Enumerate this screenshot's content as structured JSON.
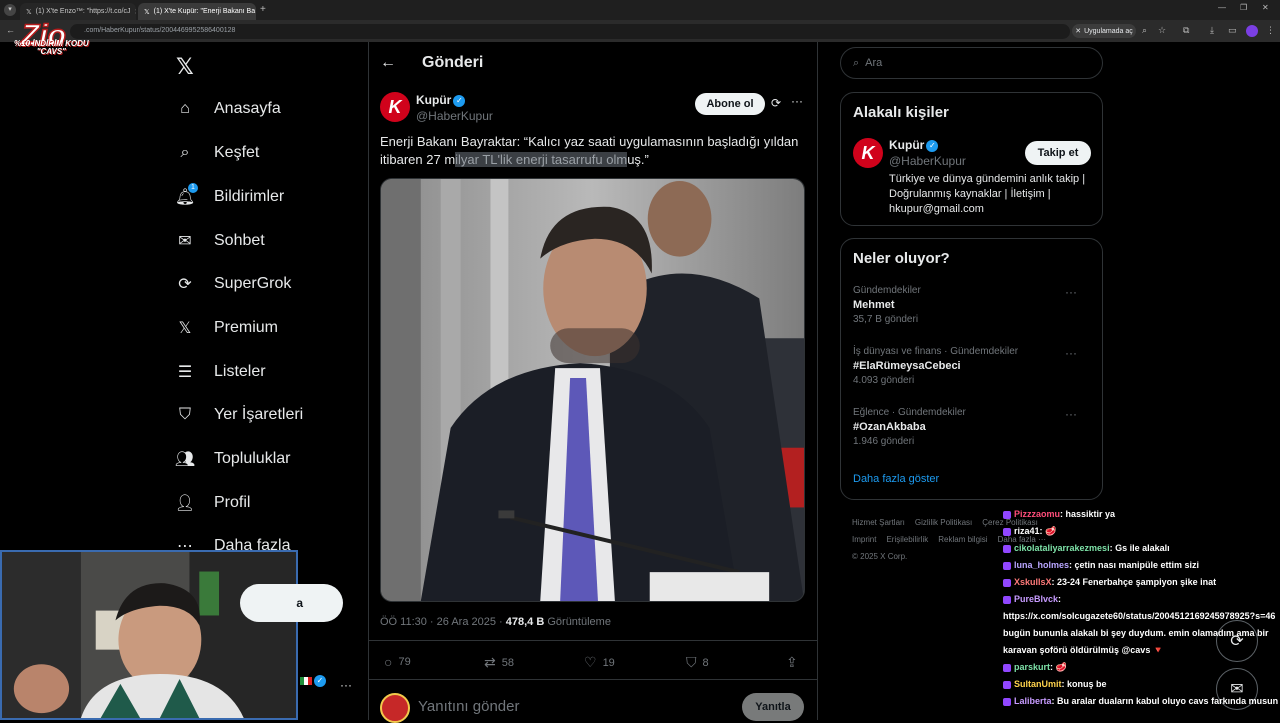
{
  "browser": {
    "tabs": [
      {
        "label": "(1) X'te Enzo™: \"https://t.co/cJ",
        "active": false
      },
      {
        "label": "(1) X'te Kupür: \"Enerji Bakanı Ba",
        "active": true
      }
    ],
    "url": ".com/HaberKupur/status/2004469952586400128",
    "promo_label": "Uygulamada aç"
  },
  "stream_logo": {
    "text": "Zio",
    "promo_line1": "%10 İNDİRİM KODU",
    "promo_line2": "\"CAVS\""
  },
  "nav": {
    "items": [
      {
        "label": "Anasayfa",
        "icon": "home-icon"
      },
      {
        "label": "Keşfet",
        "icon": "search-icon"
      },
      {
        "label": "Bildirimler",
        "icon": "bell-icon",
        "badge": "1"
      },
      {
        "label": "Sohbet",
        "icon": "mail-icon"
      },
      {
        "label": "SuperGrok",
        "icon": "grok-icon"
      },
      {
        "label": "Premium",
        "icon": "x-icon"
      },
      {
        "label": "Listeler",
        "icon": "list-icon"
      },
      {
        "label": "Yer İşaretleri",
        "icon": "bookmark-icon"
      },
      {
        "label": "Topluluklar",
        "icon": "people-icon"
      },
      {
        "label": "Profil",
        "icon": "person-icon"
      },
      {
        "label": "Daha fazla",
        "icon": "more-circle-icon"
      }
    ],
    "post_button_partial": "a"
  },
  "post": {
    "header_title": "Gönderi",
    "author_name": "Kupür",
    "author_handle": "@HaberKupur",
    "subscribe_label": "Abone ol",
    "text_before": "Enerji Bakanı Bayraktar: “Kalıcı yaz saati uygulamasının başladığı yıldan itibaren 27 m",
    "text_highlight": "ilyar TL'lik enerji tasarrufu olm",
    "text_after": "uş.”",
    "time": "ÖÖ 11:30 · 26 Ara 2025 · ",
    "views": "478,4 B",
    "views_label": " Görüntüleme",
    "replies": "79",
    "reposts": "58",
    "likes": "19",
    "bookmarks": "8",
    "reply_placeholder": "Yanıtını gönder",
    "reply_button": "Yanıtla"
  },
  "sidebar": {
    "search_placeholder": "Ara",
    "related": {
      "title": "Alakalı kişiler",
      "name": "Kupür",
      "handle": "@HaberKupur",
      "follow_label": "Takip et",
      "bio": "Türkiye ve dünya gündemini anlık takip | Doğrulanmış kaynaklar | İletişim | hkupur@gmail.com"
    },
    "trends": {
      "title": "Neler oluyor?",
      "items": [
        {
          "category": "Gündemdekiler",
          "name": "Mehmet",
          "count": "35,7 B gönderi"
        },
        {
          "category": "İş dünyası ve finans · Gündemdekiler",
          "name": "#ElaRümeysaCebeci",
          "count": "4.093 gönderi"
        },
        {
          "category": "Eğlence · Gündemdekiler",
          "name": "#OzanAkbaba",
          "count": "1.946 gönderi"
        }
      ],
      "show_more": "Daha fazla göster"
    },
    "footer": {
      "terms": "Hizmet Şartları",
      "privacy": "Gizlilik Politikası",
      "cookies": "Çerez Politikası",
      "imprint": "Imprint",
      "accessibility": "Erişilebilirlik",
      "ads": "Reklam bilgisi",
      "more": "Daha fazla ···",
      "copyright": "© 2025 X Corp."
    }
  },
  "chat": [
    {
      "user": "Pizzzaomu",
      "color": "#ff4d7a",
      "text": ": hassiktir ya"
    },
    {
      "user": "riza41",
      "color": "#ffffff",
      "text": ": 🥩"
    },
    {
      "user": "cikolataliyarrakezmesi",
      "color": "#7ee2a8",
      "text": ": Gs ile alakalı"
    },
    {
      "user": "luna_holmes",
      "color": "#b9a6ff",
      "text": ": çetin nası manipüle ettim sizi"
    },
    {
      "user": "XskullsX",
      "color": "#ff7a7a",
      "text": ": 23-24 Fenerbahçe şampiyon şike inat"
    },
    {
      "user": "PureBlvck",
      "color": "#c79bff",
      "text": ": https://x.com/solcugazete60/status/2004512169245978925?s=46 bugün bununla alakalı bi şey duydum. emin olamadım ama bir karavan şoförü öldürülmüş @cavs 🔻"
    },
    {
      "user": "parskurt",
      "color": "#7ee2a8",
      "text": ": 🥩"
    },
    {
      "user": "SultanUmit",
      "color": "#ffd34d",
      "text": ": konuş be"
    },
    {
      "user": "Laliberta",
      "color": "#c79bff",
      "text": ": Bu aralar duaların kabul oluyo cavs farkında musun"
    }
  ]
}
